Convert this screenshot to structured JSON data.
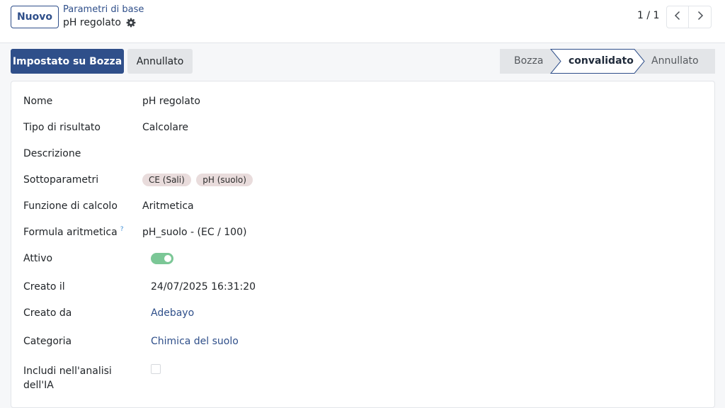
{
  "control_panel": {
    "new_button": "Nuovo",
    "breadcrumb_parent": "Parametri di base",
    "record_title": "pH regolato",
    "pager_value": "1 / 1"
  },
  "actions": {
    "set_draft": "Impostato su Bozza",
    "cancel": "Annullato"
  },
  "statusbar": {
    "stages": [
      "Bozza",
      "convalidato",
      "Annullato"
    ],
    "active_stage": "convalidato"
  },
  "form": {
    "nome": {
      "label": "Nome",
      "value": "pH regolato"
    },
    "tipo": {
      "label": "Tipo di risultato",
      "value": "Calcolare"
    },
    "descrizione": {
      "label": "Descrizione",
      "value": ""
    },
    "sottoparametri": {
      "label": "Sottoparametri",
      "tags": [
        "CE (Sali)",
        "pH (suolo)"
      ]
    },
    "funzione": {
      "label": "Funzione di calcolo",
      "value": "Aritmetica"
    },
    "formula": {
      "label": "Formula aritmetica",
      "help": "?",
      "value": "pH_suolo - (EC / 100)"
    },
    "attivo": {
      "label": "Attivo",
      "value": true
    },
    "creato_il": {
      "label": "Creato il",
      "value": "24/07/2025 16:31:20"
    },
    "creato_da": {
      "label": "Creato da",
      "value": "Adebayo"
    },
    "categoria": {
      "label": "Categoria",
      "value": "Chimica del suolo"
    },
    "includi_ia": {
      "label_line1": "Includi nell'analisi",
      "label_line2": "dell'IA",
      "value": false
    }
  },
  "colors": {
    "primary": "#2f4f8a",
    "toggle_on": "#7bc796",
    "tag_bg": "#e9dcdc"
  }
}
